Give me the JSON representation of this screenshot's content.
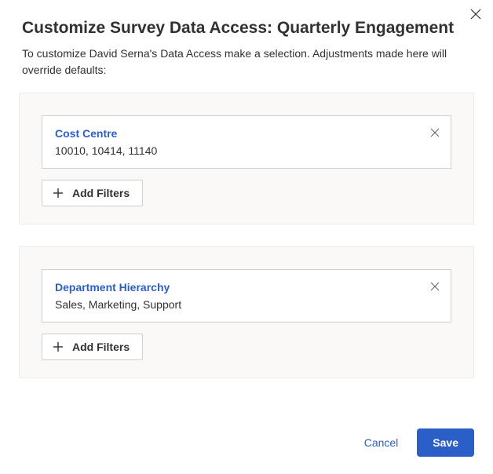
{
  "header": {
    "title": "Customize Survey Data Access: Quarterly Engagement",
    "subtitle": "To customize David Serna's Data Access make a selection. Adjustments made here will override defaults:"
  },
  "sections": [
    {
      "filter_label": "Cost Centre",
      "filter_values": "10010, 10414, 11140",
      "add_label": "Add Filters"
    },
    {
      "filter_label": "Department Hierarchy",
      "filter_values": "Sales, Marketing, Support",
      "add_label": "Add Filters"
    }
  ],
  "footer": {
    "cancel": "Cancel",
    "save": "Save"
  }
}
